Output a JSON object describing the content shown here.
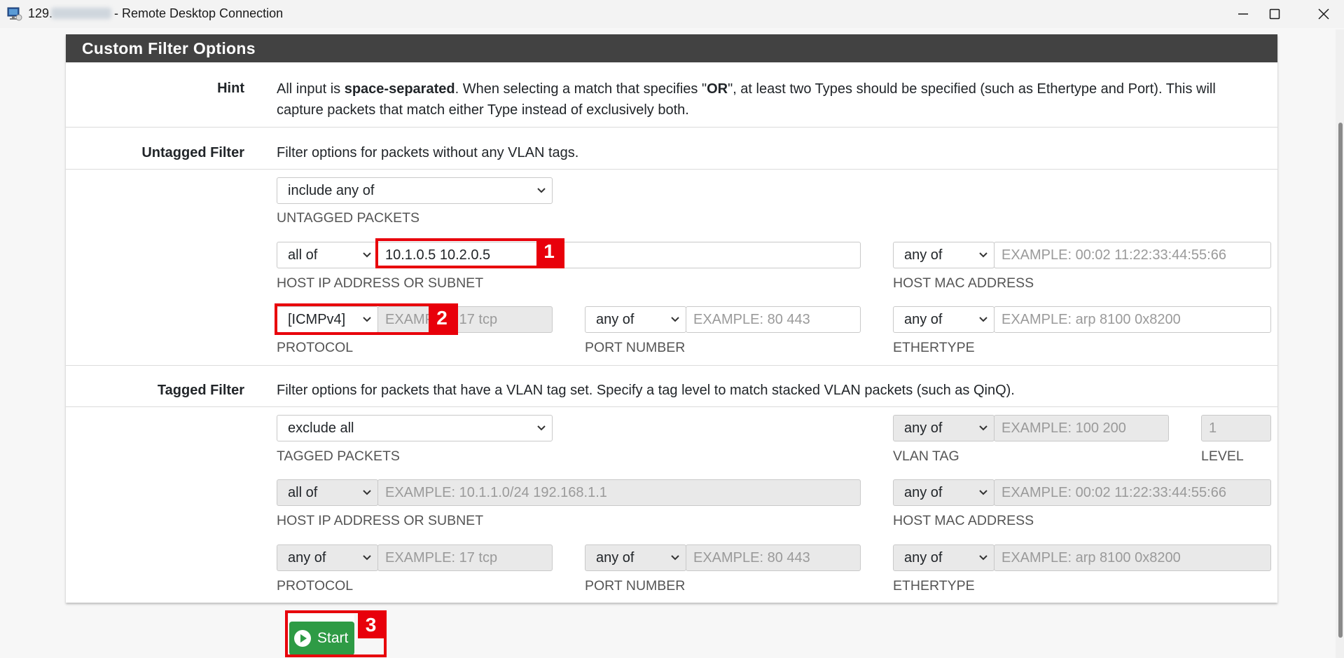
{
  "window": {
    "title_ip_prefix": "129.",
    "title_suffix": "- Remote Desktop Connection",
    "minimize_icon": "minimize-icon",
    "maximize_icon": "maximize-icon",
    "close_icon": "close-icon"
  },
  "panel": {
    "title": "Custom Filter Options"
  },
  "hint": {
    "label": "Hint",
    "text_part1": "All input is ",
    "text_bold1": "space-separated",
    "text_part2": ". When selecting a match that specifies \"",
    "text_bold2": "OR",
    "text_part3": "\", at least two Types should be specified (such as Ethertype and Port). This will",
    "text_line2": "capture packets that match either Type instead of exclusively both."
  },
  "untagged": {
    "label": "Untagged Filter",
    "description": "Filter options for packets without any VLAN tags.",
    "packets_select": "include any of",
    "packets_label": "UNTAGGED PACKETS",
    "host_ip_match": "all of",
    "host_ip_value": "10.1.0.5 10.2.0.5",
    "host_ip_label": "HOST IP ADDRESS OR SUBNET",
    "host_mac_match": "any of",
    "host_mac_placeholder": "EXAMPLE: 00:02 11:22:33:44:55:66",
    "host_mac_label": "HOST MAC ADDRESS",
    "protocol_match": "[ICMPv4]",
    "protocol_placeholder": "EXAMPLE: 17 tcp",
    "protocol_label": "PROTOCOL",
    "port_match": "any of",
    "port_placeholder": "EXAMPLE: 80 443",
    "port_label": "PORT NUMBER",
    "ethertype_match": "any of",
    "ethertype_placeholder": "EXAMPLE: arp 8100 0x8200",
    "ethertype_label": "ETHERTYPE"
  },
  "tagged": {
    "label": "Tagged Filter",
    "description": "Filter options for packets that have a VLAN tag set. Specify a tag level to match stacked VLAN packets (such as QinQ).",
    "packets_select": "exclude all",
    "packets_label": "TAGGED PACKETS",
    "vlan_match": "any of",
    "vlan_placeholder": "EXAMPLE: 100 200",
    "vlan_label": "VLAN TAG",
    "level_placeholder": "1",
    "level_label": "LEVEL",
    "host_ip_match": "all of",
    "host_ip_placeholder": "EXAMPLE: 10.1.1.0/24 192.168.1.1",
    "host_ip_label": "HOST IP ADDRESS OR SUBNET",
    "host_mac_match": "any of",
    "host_mac_placeholder": "EXAMPLE: 00:02 11:22:33:44:55:66",
    "host_mac_label": "HOST MAC ADDRESS",
    "protocol_match": "any of",
    "protocol_placeholder": "EXAMPLE: 17 tcp",
    "protocol_label": "PROTOCOL",
    "port_match": "any of",
    "port_placeholder": "EXAMPLE: 80 443",
    "port_label": "PORT NUMBER",
    "ethertype_match": "any of",
    "ethertype_placeholder": "EXAMPLE: arp 8100 0x8200",
    "ethertype_label": "ETHERTYPE"
  },
  "start_button": {
    "label": "Start",
    "icon": "play-circle-icon"
  },
  "annotations": {
    "marker_1": "1",
    "marker_2": "2",
    "marker_3": "3"
  },
  "colors": {
    "header_bg": "#424242",
    "annotation_red": "#e8000b",
    "start_green": "#2e9b45"
  }
}
